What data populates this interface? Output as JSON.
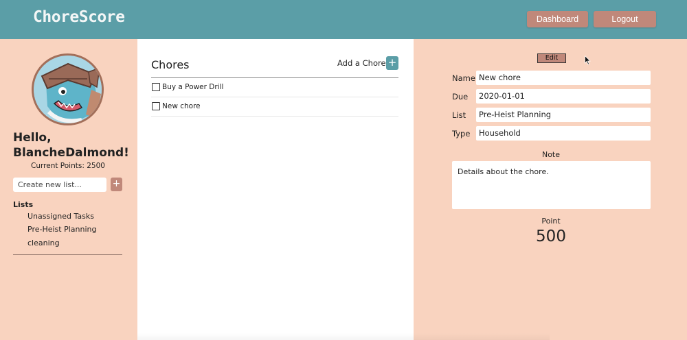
{
  "header": {
    "brand": "ChoreScore",
    "dashboard_label": "Dashboard",
    "logout_label": "Logout",
    "brand_color": "#5b9ea7"
  },
  "sidebar": {
    "greeting": "Hello, BlancheDalmond!",
    "points_text": "Current Points: 2500",
    "new_list_placeholder": "Create new list...",
    "add_list_label": "+",
    "lists_heading": "Lists",
    "lists": [
      "Unassigned Tasks",
      "Pre-Heist Planning",
      "cleaning"
    ],
    "background_color": "#f9d3bf"
  },
  "chores": {
    "title": "Chores",
    "add_label": "Add a Chore",
    "add_button_label": "+",
    "items": [
      "Buy a Power Drill",
      "New chore"
    ]
  },
  "detail": {
    "edit_label": "Edit",
    "fields": [
      {
        "label": "Name",
        "value": "New chore"
      },
      {
        "label": "Due",
        "value": "2020-01-01"
      },
      {
        "label": "List",
        "value": "Pre-Heist Planning"
      },
      {
        "label": "Type",
        "value": "Household"
      }
    ],
    "note_label": "Note",
    "note_text": "Details about the chore.",
    "point_label": "Point",
    "point_value": "500",
    "button_color": "#c0887a"
  }
}
